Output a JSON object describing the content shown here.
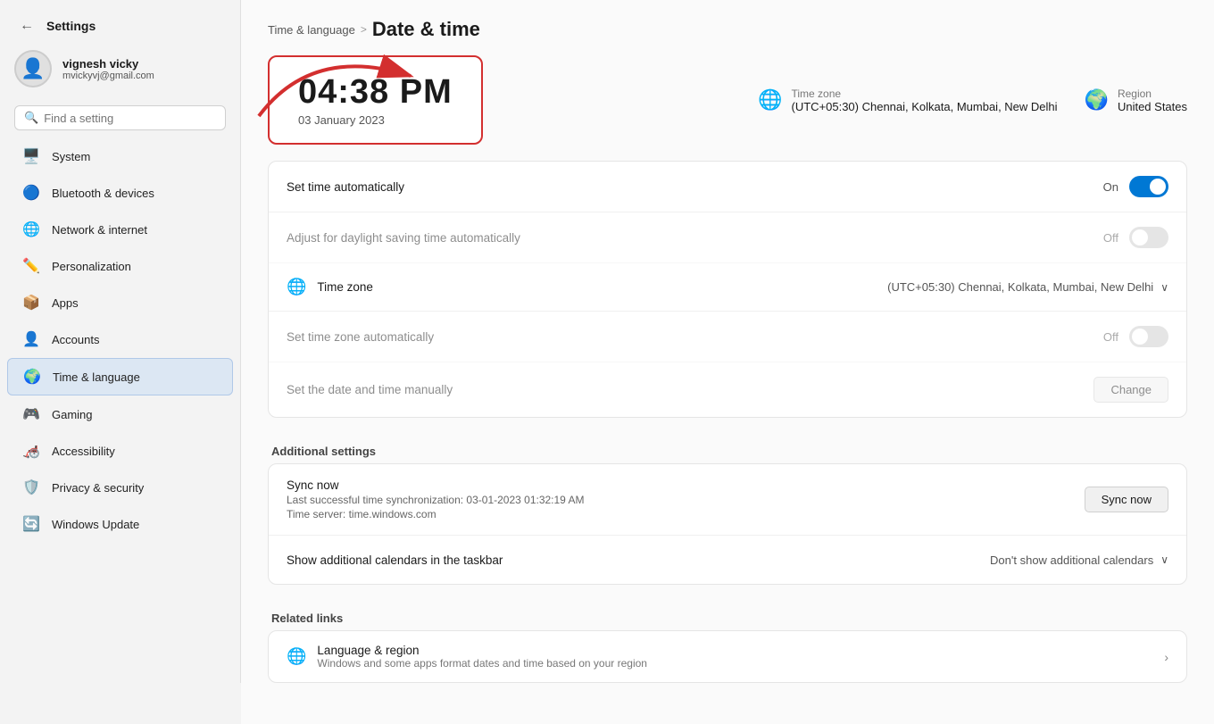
{
  "app": {
    "title": "Settings",
    "back_label": "←"
  },
  "user": {
    "name": "vignesh vicky",
    "email": "mvickyvj@gmail.com"
  },
  "search": {
    "placeholder": "Find a setting"
  },
  "sidebar": {
    "items": [
      {
        "id": "system",
        "label": "System",
        "icon": "🖥️"
      },
      {
        "id": "bluetooth",
        "label": "Bluetooth & devices",
        "icon": "🔵"
      },
      {
        "id": "network",
        "label": "Network & internet",
        "icon": "🌐"
      },
      {
        "id": "personalization",
        "label": "Personalization",
        "icon": "✏️"
      },
      {
        "id": "apps",
        "label": "Apps",
        "icon": "📦"
      },
      {
        "id": "accounts",
        "label": "Accounts",
        "icon": "👤"
      },
      {
        "id": "time",
        "label": "Time & language",
        "icon": "🌍",
        "active": true
      },
      {
        "id": "gaming",
        "label": "Gaming",
        "icon": "🎮"
      },
      {
        "id": "accessibility",
        "label": "Accessibility",
        "icon": "🦽"
      },
      {
        "id": "privacy",
        "label": "Privacy & security",
        "icon": "🛡️"
      },
      {
        "id": "update",
        "label": "Windows Update",
        "icon": "🔄"
      }
    ]
  },
  "breadcrumb": {
    "parent": "Time & language",
    "separator": ">",
    "current": "Date & time"
  },
  "time_card": {
    "time": "04:38 PM",
    "date": "03 January 2023"
  },
  "header_info": {
    "timezone_label": "Time zone",
    "timezone_value": "(UTC+05:30) Chennai, Kolkata, Mumbai, New Delhi",
    "region_label": "Region",
    "region_value": "United States"
  },
  "settings": {
    "set_time_auto": {
      "label": "Set time automatically",
      "state": "On",
      "toggle": "on"
    },
    "daylight_saving": {
      "label": "Adjust for daylight saving time automatically",
      "state": "Off",
      "toggle": "off",
      "disabled": true
    },
    "timezone": {
      "label": "Time zone",
      "value": "(UTC+05:30) Chennai, Kolkata, Mumbai, New Delhi"
    },
    "set_timezone_auto": {
      "label": "Set time zone automatically",
      "state": "Off",
      "toggle": "off",
      "disabled": true
    },
    "set_date_manually": {
      "label": "Set the date and time manually",
      "button": "Change",
      "disabled": true
    }
  },
  "additional_settings": {
    "header": "Additional settings",
    "sync_now": {
      "title": "Sync now",
      "detail1": "Last successful time synchronization: 03-01-2023 01:32:19 AM",
      "detail2": "Time server: time.windows.com",
      "button": "Sync now"
    },
    "calendars": {
      "label": "Show additional calendars in the taskbar",
      "value": "Don't show additional calendars"
    }
  },
  "related_links": {
    "header": "Related links",
    "items": [
      {
        "title": "Language & region",
        "subtitle": "Windows and some apps format dates and time based on your region"
      }
    ]
  },
  "colors": {
    "accent": "#0078d4",
    "active_bg": "#dce7f3",
    "toggle_on": "#0078d4",
    "toggle_off": "#ccc",
    "red_highlight": "#d32f2f"
  }
}
